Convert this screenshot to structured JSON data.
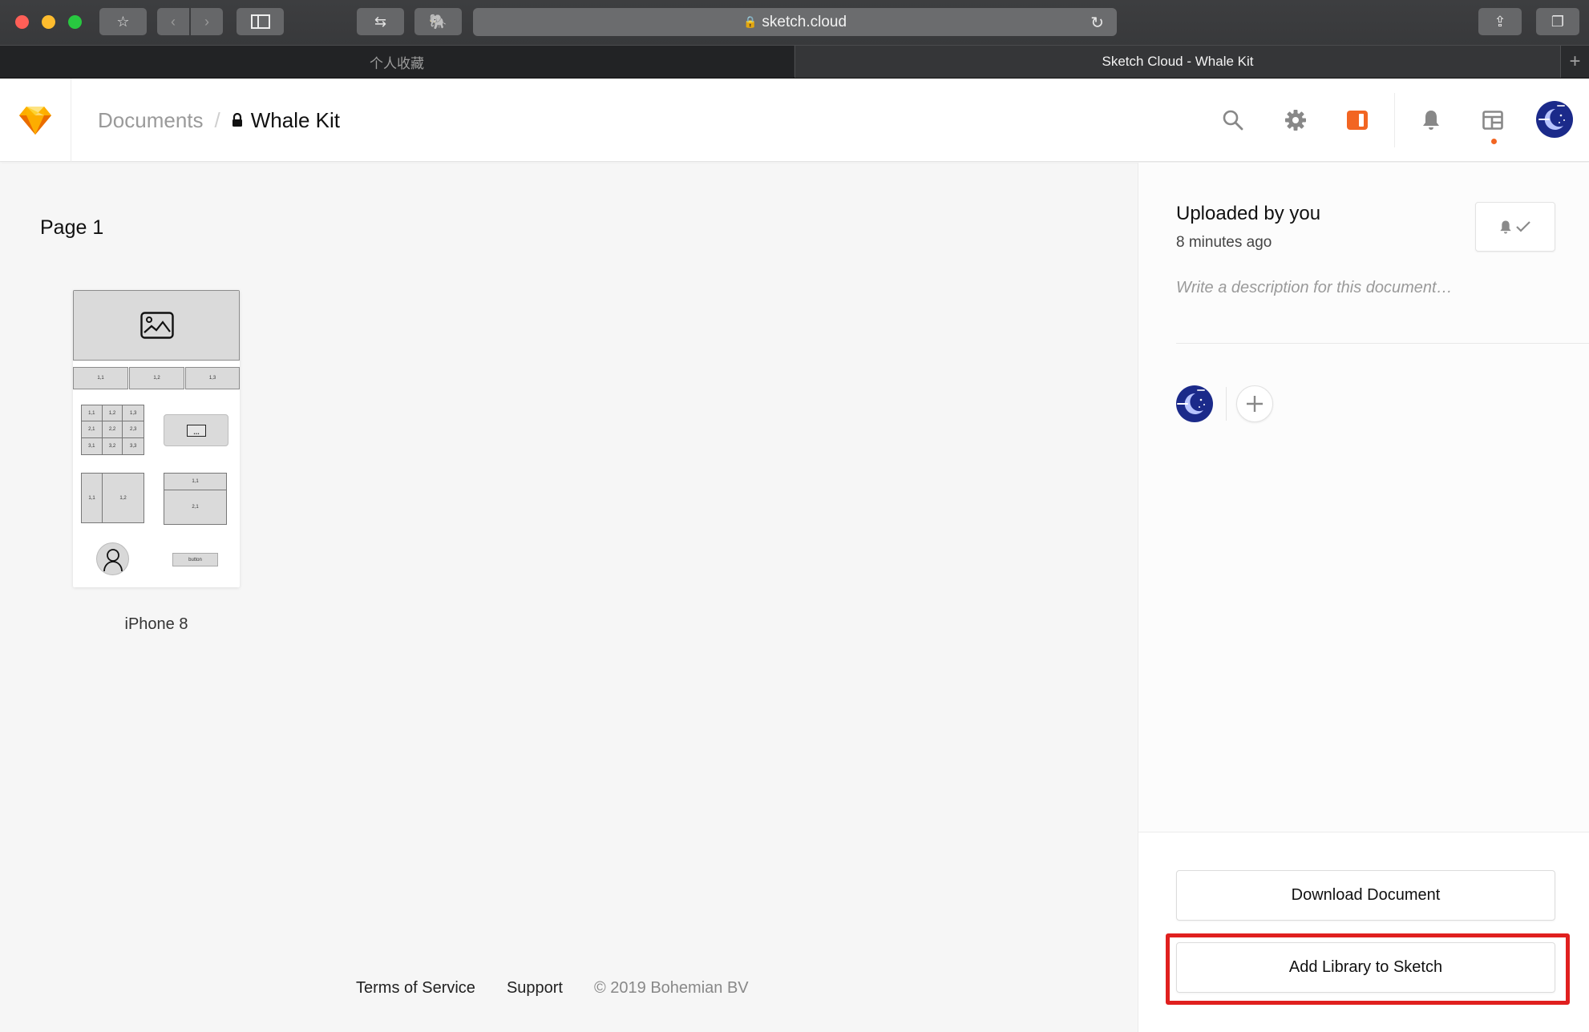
{
  "browser": {
    "url": "sketch.cloud",
    "tabs": [
      {
        "label": "个人收藏",
        "active": false
      },
      {
        "label": "Sketch Cloud - Whale Kit",
        "active": true
      }
    ],
    "new_tab_icon": "+",
    "toolbar_icons": [
      "bookmarks-icon",
      "back-icon",
      "forward-icon",
      "sidebar-icon",
      "transfer-icon",
      "evernote-icon",
      "share-icon",
      "tabs-overview-icon"
    ]
  },
  "header": {
    "breadcrumb_root": "Documents",
    "breadcrumb_separator": "/",
    "document_title": "Whale Kit",
    "icons": [
      "search-icon",
      "settings-icon",
      "sidebar-toggle-icon",
      "notifications-icon",
      "layout-icon",
      "avatar"
    ],
    "accent_color": "#f26522",
    "notification_dot": true
  },
  "main": {
    "page_title": "Page 1",
    "artboards": [
      {
        "label": "iPhone 8",
        "tab_labels": [
          "1,1",
          "1,2",
          "1,3"
        ],
        "grid_labels": [
          "1,1",
          "1,2",
          "1,3",
          "2,1",
          "2,2",
          "2,3",
          "3,1",
          "3,2",
          "3,3"
        ],
        "split_labels": [
          "1,1",
          "1,2"
        ],
        "stack_labels": [
          "1,1",
          "2,1"
        ],
        "button_label": "button",
        "input_placeholder": "..."
      }
    ]
  },
  "panel": {
    "uploaded_by": "Uploaded by you",
    "uploaded_time": "8 minutes ago",
    "description_placeholder": "Write a description for this document…",
    "download_label": "Download Document",
    "add_library_label": "Add Library to Sketch",
    "highlight_color": "#e0201f"
  },
  "footer": {
    "terms": "Terms of Service",
    "support": "Support",
    "copyright": "© 2019 Bohemian BV"
  }
}
